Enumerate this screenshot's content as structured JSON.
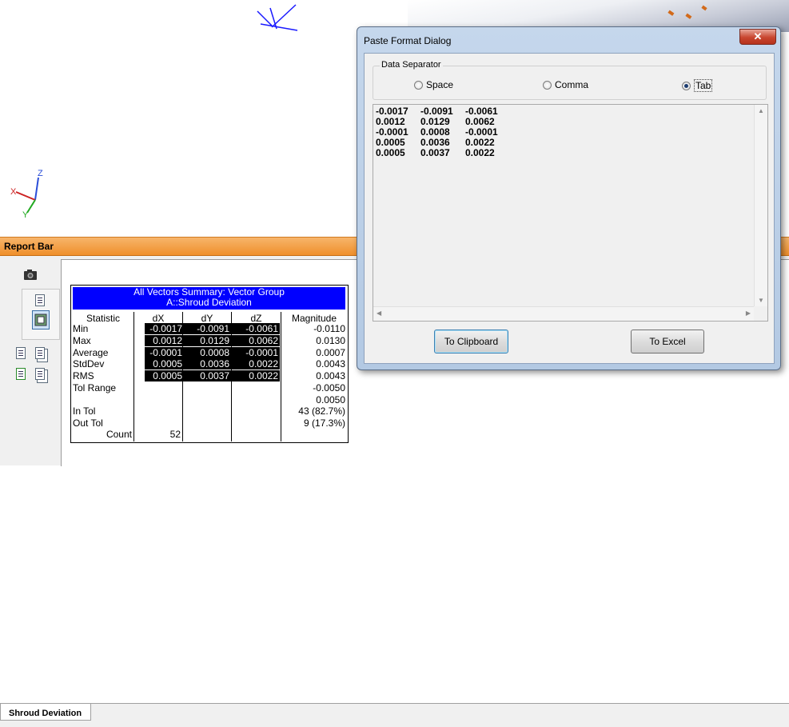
{
  "report_bar": {
    "title": "Report Bar",
    "bottom_tab": "Shroud Deviation"
  },
  "summary": {
    "title_line1": "All Vectors Summary: Vector Group",
    "title_line2": "A::Shroud Deviation",
    "headers": [
      "Statistic",
      "dX",
      "dY",
      "dZ",
      "Magnitude"
    ],
    "rows": [
      {
        "label": "Min",
        "dx": "-0.0017",
        "dy": "-0.0091",
        "dz": "-0.0061",
        "mag": "-0.0110"
      },
      {
        "label": "Max",
        "dx": "0.0012",
        "dy": "0.0129",
        "dz": "0.0062",
        "mag": "0.0130"
      },
      {
        "label": "Average",
        "dx": "-0.0001",
        "dy": "0.0008",
        "dz": "-0.0001",
        "mag": "0.0007"
      },
      {
        "label": "StdDev",
        "dx": "0.0005",
        "dy": "0.0036",
        "dz": "0.0022",
        "mag": "0.0043"
      },
      {
        "label": "RMS",
        "dx": "0.0005",
        "dy": "0.0037",
        "dz": "0.0022",
        "mag": "0.0043"
      }
    ],
    "tol_range_label": "Tol Range",
    "tol_range_low": "-0.0050",
    "tol_range_high": "0.0050",
    "in_tol_label": "In Tol",
    "in_tol_value": "43 (82.7%)",
    "out_tol_label": "Out Tol",
    "out_tol_value": "9 (17.3%)",
    "count_label": "Count",
    "count_value": "52"
  },
  "dialog": {
    "title": "Paste Format Dialog",
    "close_glyph": "✕",
    "group_label": "Data Separator",
    "options": [
      "Space",
      "Comma",
      "Tab"
    ],
    "selected_option": "Tab",
    "output_rows": [
      [
        "-0.0017",
        "-0.0091",
        "-0.0061"
      ],
      [
        "0.0012",
        "0.0129",
        "0.0062"
      ],
      [
        "-0.0001",
        "0.0008",
        "-0.0001"
      ],
      [
        "0.0005",
        "0.0036",
        "0.0022"
      ],
      [
        "0.0005",
        "0.0037",
        "0.0022"
      ]
    ],
    "clipboard_button": "To Clipboard",
    "excel_button": "To Excel"
  },
  "axis_labels": {
    "z": "Z",
    "x": "X",
    "y": "Y"
  },
  "colors": {
    "header_blue": "#0000ff",
    "title_orange": "#ef8f2b",
    "highlight": "#000000"
  }
}
